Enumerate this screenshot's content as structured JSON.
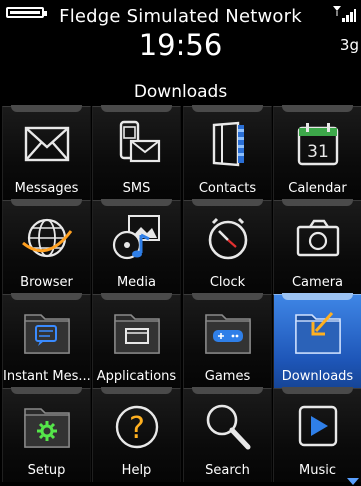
{
  "status": {
    "carrier": "Fledge Simulated Network",
    "time": "19:56",
    "network_type": "3g",
    "battery_level": 1.0,
    "signal_bars": 4
  },
  "folder_title": "Downloads",
  "apps": [
    {
      "label": "Messages",
      "icon": "envelope-icon"
    },
    {
      "label": "SMS",
      "icon": "sms-icon"
    },
    {
      "label": "Contacts",
      "icon": "address-book-icon"
    },
    {
      "label": "Calendar",
      "icon": "calendar-icon",
      "calendar_day": "31"
    },
    {
      "label": "Browser",
      "icon": "globe-icon"
    },
    {
      "label": "Media",
      "icon": "media-icon"
    },
    {
      "label": "Clock",
      "icon": "clock-icon"
    },
    {
      "label": "Camera",
      "icon": "camera-icon"
    },
    {
      "label": "Instant Mes...",
      "icon": "chat-folder-icon"
    },
    {
      "label": "Applications",
      "icon": "applications-folder-icon"
    },
    {
      "label": "Games",
      "icon": "gamepad-folder-icon"
    },
    {
      "label": "Downloads",
      "icon": "downloads-folder-icon",
      "selected": true
    },
    {
      "label": "Setup",
      "icon": "setup-folder-icon"
    },
    {
      "label": "Help",
      "icon": "help-icon"
    },
    {
      "label": "Search",
      "icon": "magnifier-icon"
    },
    {
      "label": "Music",
      "icon": "music-play-icon"
    }
  ],
  "colors": {
    "selection": "#1e56b8",
    "folder_accent": "#3a8bff",
    "setup_accent": "#55e64a"
  }
}
